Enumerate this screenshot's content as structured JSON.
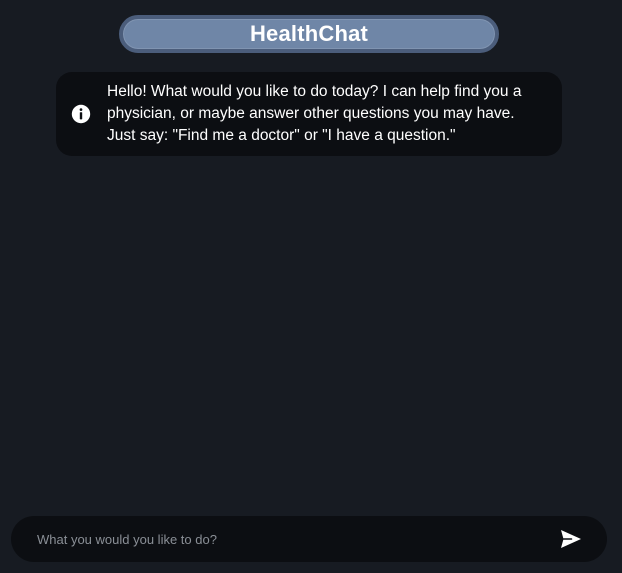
{
  "header": {
    "title": "HealthChat"
  },
  "conversation": {
    "messages": [
      {
        "icon": "info-icon",
        "text": "Hello! What would you like to do today? I can help find you a physician, or maybe answer other questions you may have. Just say: \"Find me a doctor\" or \"I have a question.\""
      }
    ]
  },
  "composer": {
    "value": "",
    "placeholder": "What you would you like to do?",
    "send_icon": "send-icon"
  },
  "colors": {
    "background": "#171b22",
    "header_fill": "#6f86a7",
    "header_border": "#4b5d7b",
    "panel": "#0c0e12",
    "text": "#ffffff"
  }
}
